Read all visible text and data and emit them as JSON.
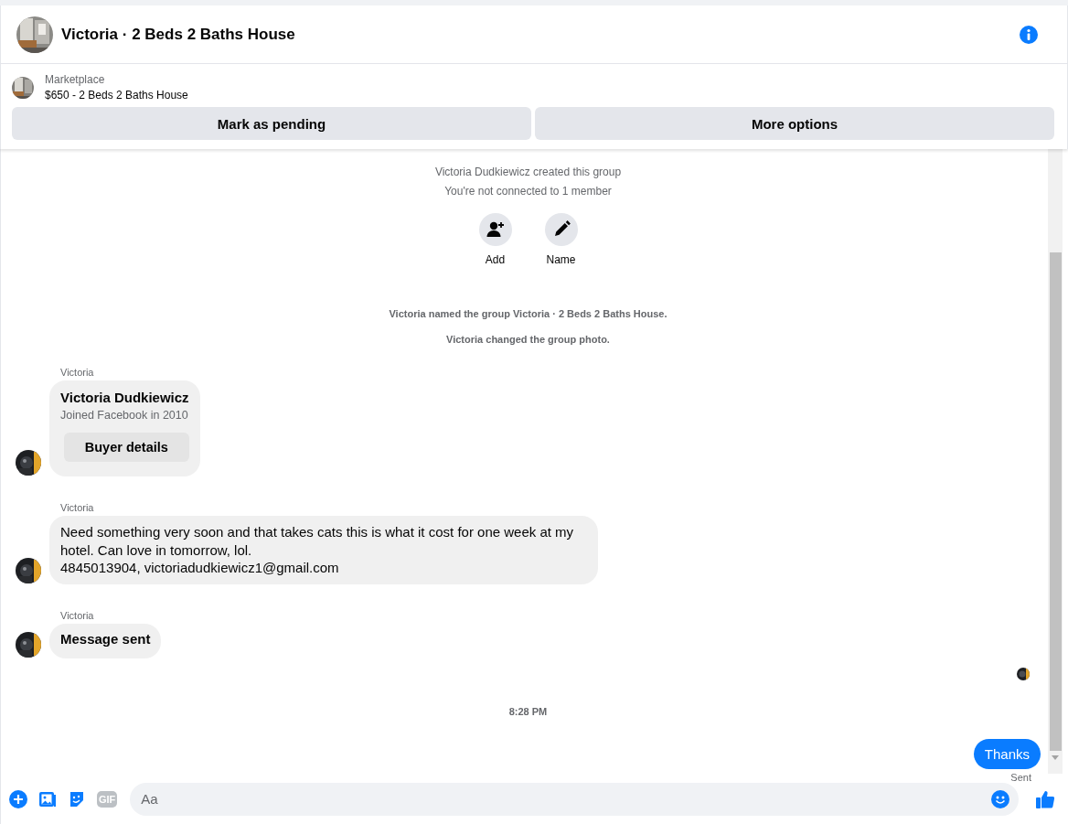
{
  "header": {
    "title": "Victoria · 2 Beds 2 Baths House"
  },
  "listing": {
    "source": "Marketplace",
    "item": "$650 - 2 Beds 2 Baths House",
    "buttons": [
      "Mark as pending",
      "More options"
    ]
  },
  "group_info": {
    "lines": [
      "Victoria Dudkiewicz created this group",
      "You're not connected to 1 member"
    ],
    "actions": [
      {
        "kind": "add",
        "label": "Add"
      },
      {
        "kind": "name",
        "label": "Name"
      }
    ]
  },
  "events": [
    "Victoria named the group Victoria · 2 Beds 2 Baths House.",
    "Victoria changed the group photo."
  ],
  "messages": [
    {
      "sender": "Victoria",
      "kind": "card",
      "name": "Victoria Dudkiewicz",
      "detail": "Joined Facebook in 2010",
      "button": "Buyer details"
    },
    {
      "sender": "Victoria",
      "kind": "text",
      "lines": [
        "Need something very soon and that takes cats this is what it cost for one week at my hotel. Can love in tomorrow, lol.",
        "4845013904, victoriadudkiewicz1@gmail.com"
      ]
    },
    {
      "sender": "Victoria",
      "kind": "status",
      "text": "Message sent"
    }
  ],
  "timestamp": "8:28 PM",
  "outgoing": {
    "text": "Thanks",
    "status": "Sent"
  },
  "composer": {
    "gif_label": "GIF",
    "placeholder": "Aa"
  }
}
